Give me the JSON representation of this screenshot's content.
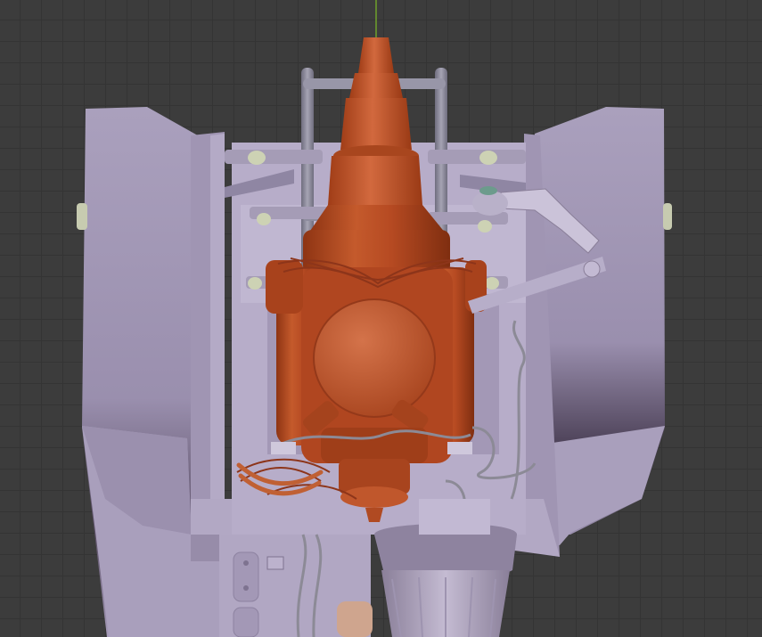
{
  "app": {
    "view": "3d-viewport",
    "scene_object": "engine-assembly-model"
  },
  "colors": {
    "background": "#3c3c3c",
    "grid_line": "#343434",
    "axis_y": "#6ea02b",
    "engine": "#b64a22",
    "engine_highlight": "#d2693e",
    "frame": "#a59ab8",
    "frame_shadow": "#4a3f55",
    "tube": "#8a889a",
    "wire": "#8c8a96"
  },
  "icons": {
    "axis": "y-axis-line-icon"
  }
}
